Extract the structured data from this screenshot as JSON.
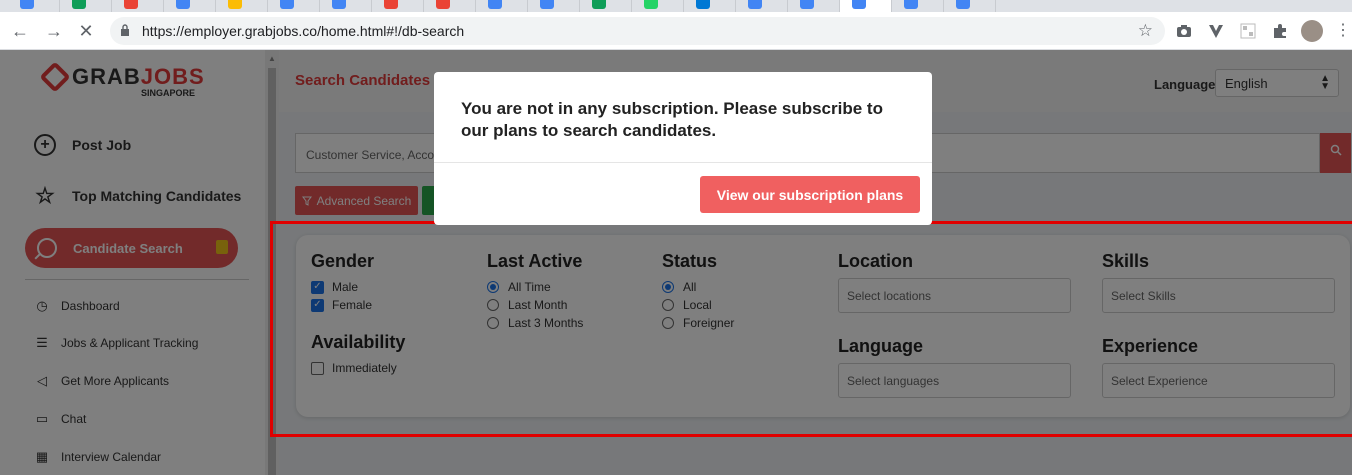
{
  "browser": {
    "url": "https://employer.grabjobs.co/home.html#!/db-search",
    "back_icon": "←",
    "forward_icon": "→",
    "stop_icon": "✕",
    "star_icon": "☆",
    "kebab_icon": "⋮",
    "extension_icons": [
      "camera-icon",
      "vivaldi-icon",
      "qr-icon",
      "puzzle-icon"
    ],
    "tab_colors": [
      "#4285f4",
      "#0f9d58",
      "#ea4335",
      "#4285f4",
      "#fbbc05",
      "#4285f4",
      "#4285f4",
      "#ea4335",
      "#ea4335",
      "#4285f4",
      "#4285f4",
      "#0f9d58",
      "#25d366",
      "#0078d4",
      "#4285f4",
      "#4285f4",
      "#4285f4",
      "#4285f4",
      "#4285f4"
    ]
  },
  "sidebar": {
    "logo_part1": "GRAB",
    "logo_part2": "JOBS",
    "logo_sub": "SINGAPORE",
    "post_job": "Post Job",
    "top_matching": "Top Matching Candidates",
    "candidate_search": "Candidate Search",
    "links": [
      {
        "label": "Dashboard",
        "icon": "◷"
      },
      {
        "label": "Jobs & Applicant Tracking",
        "icon": "☰"
      },
      {
        "label": "Get More Applicants",
        "icon": "◁"
      },
      {
        "label": "Chat",
        "icon": "▭"
      },
      {
        "label": "Interview Calendar",
        "icon": "▦"
      }
    ]
  },
  "main": {
    "title": "Search Candidates f",
    "language_label": "Language",
    "language_value": "English",
    "search_value": "Customer Service, Accou",
    "advanced_search": "Advanced Search"
  },
  "filters": {
    "gender": {
      "title": "Gender",
      "options": [
        {
          "label": "Male",
          "checked": true
        },
        {
          "label": "Female",
          "checked": true
        }
      ]
    },
    "availability": {
      "title": "Availability",
      "options": [
        {
          "label": "Immediately",
          "checked": false
        }
      ]
    },
    "last_active": {
      "title": "Last Active",
      "options": [
        {
          "label": "All Time",
          "selected": true
        },
        {
          "label": "Last Month",
          "selected": false
        },
        {
          "label": "Last 3 Months",
          "selected": false
        }
      ]
    },
    "status": {
      "title": "Status",
      "options": [
        {
          "label": "All",
          "selected": true
        },
        {
          "label": "Local",
          "selected": false
        },
        {
          "label": "Foreigner",
          "selected": false
        }
      ]
    },
    "location": {
      "title": "Location",
      "placeholder": "Select locations"
    },
    "skills": {
      "title": "Skills",
      "placeholder": "Select Skills"
    },
    "language": {
      "title": "Language",
      "placeholder": "Select languages"
    },
    "experience": {
      "title": "Experience",
      "placeholder": "Select Experience"
    }
  },
  "modal": {
    "message": "You are not in any subscription. Please subscribe to our plans to search candidates.",
    "button": "View our subscription plans"
  }
}
